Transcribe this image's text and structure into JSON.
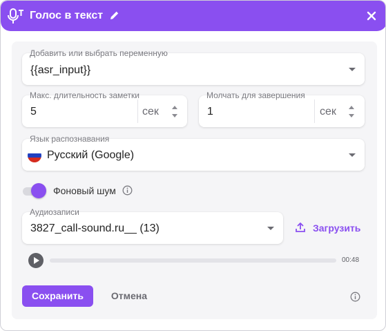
{
  "header": {
    "title": "Голос в текст",
    "icons": [
      "microphone-icon",
      "pencil-icon",
      "close-icon"
    ],
    "color": "#8a4ff0"
  },
  "variable": {
    "label": "Добавить или выбрать переменную",
    "value": "{{asr_input}}"
  },
  "max_duration": {
    "label": "Макс. длительность заметки",
    "value": "5",
    "unit": "сек"
  },
  "silence": {
    "label": "Молчать для завершения",
    "value": "1",
    "unit": "сек"
  },
  "language": {
    "label": "Язык распознавания",
    "value": "Русский (Google)",
    "flag_icon": "russia-flag-icon"
  },
  "background_noise": {
    "label": "Фоновый шум",
    "enabled": true
  },
  "recordings": {
    "label": "Аудиозаписи",
    "value": "3827_call-sound.ru__ (13)",
    "upload_label": "Загрузить"
  },
  "player": {
    "duration": "00:48",
    "progress": 0
  },
  "footer": {
    "save_label": "Сохранить",
    "cancel_label": "Отмена"
  },
  "colors": {
    "accent": "#8a4ff0",
    "panel_background": "#f5f5f7"
  }
}
